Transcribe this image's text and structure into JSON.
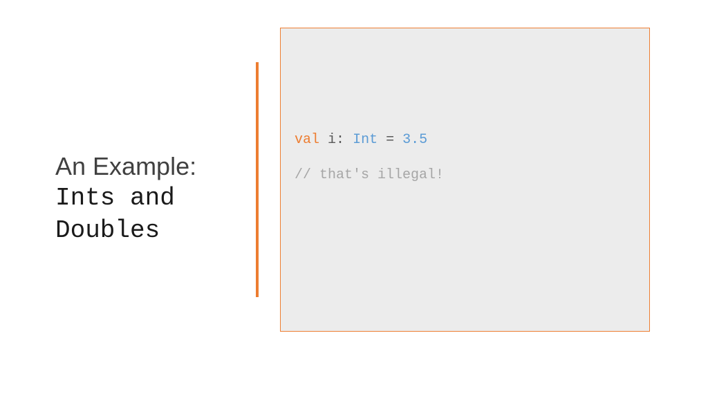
{
  "title": {
    "line1": "An Example:",
    "line2": "Ints and Doubles"
  },
  "code": {
    "keyword_val": "val",
    "space1": " ",
    "identifier": "i",
    "colon": ": ",
    "type": "Int",
    "space2": " ",
    "equals": "=",
    "space3": " ",
    "value": "3.5",
    "comment": "// that's illegal!"
  },
  "colors": {
    "accent": "#ed7d31",
    "code_bg": "#ececec",
    "keyword": "#ed7d31",
    "type": "#5b9bd5",
    "number": "#5b9bd5",
    "comment": "#a6a6a6",
    "ident": "#595959"
  }
}
